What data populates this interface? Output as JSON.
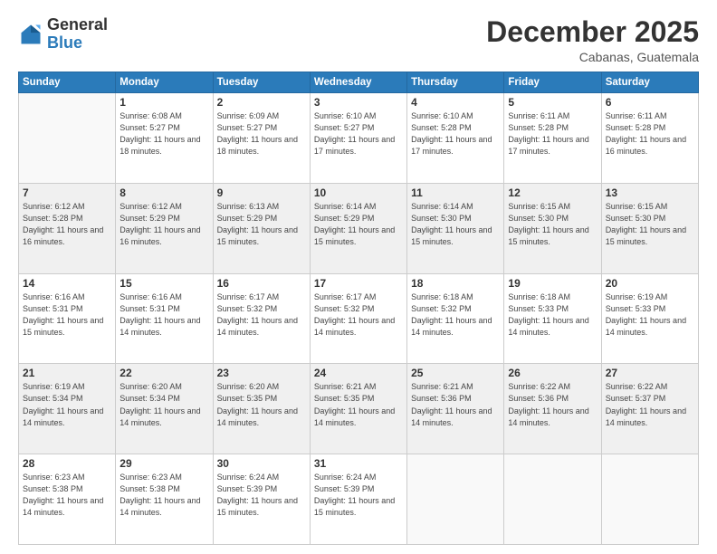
{
  "header": {
    "logo_general": "General",
    "logo_blue": "Blue",
    "month": "December 2025",
    "location": "Cabanas, Guatemala"
  },
  "weekdays": [
    "Sunday",
    "Monday",
    "Tuesday",
    "Wednesday",
    "Thursday",
    "Friday",
    "Saturday"
  ],
  "weeks": [
    [
      {
        "day": "",
        "empty": true
      },
      {
        "day": "1",
        "sunrise": "6:08 AM",
        "sunset": "5:27 PM",
        "daylight": "11 hours and 18 minutes."
      },
      {
        "day": "2",
        "sunrise": "6:09 AM",
        "sunset": "5:27 PM",
        "daylight": "11 hours and 18 minutes."
      },
      {
        "day": "3",
        "sunrise": "6:10 AM",
        "sunset": "5:27 PM",
        "daylight": "11 hours and 17 minutes."
      },
      {
        "day": "4",
        "sunrise": "6:10 AM",
        "sunset": "5:28 PM",
        "daylight": "11 hours and 17 minutes."
      },
      {
        "day": "5",
        "sunrise": "6:11 AM",
        "sunset": "5:28 PM",
        "daylight": "11 hours and 17 minutes."
      },
      {
        "day": "6",
        "sunrise": "6:11 AM",
        "sunset": "5:28 PM",
        "daylight": "11 hours and 16 minutes."
      }
    ],
    [
      {
        "day": "7",
        "sunrise": "6:12 AM",
        "sunset": "5:28 PM",
        "daylight": "11 hours and 16 minutes."
      },
      {
        "day": "8",
        "sunrise": "6:12 AM",
        "sunset": "5:29 PM",
        "daylight": "11 hours and 16 minutes."
      },
      {
        "day": "9",
        "sunrise": "6:13 AM",
        "sunset": "5:29 PM",
        "daylight": "11 hours and 15 minutes."
      },
      {
        "day": "10",
        "sunrise": "6:14 AM",
        "sunset": "5:29 PM",
        "daylight": "11 hours and 15 minutes."
      },
      {
        "day": "11",
        "sunrise": "6:14 AM",
        "sunset": "5:30 PM",
        "daylight": "11 hours and 15 minutes."
      },
      {
        "day": "12",
        "sunrise": "6:15 AM",
        "sunset": "5:30 PM",
        "daylight": "11 hours and 15 minutes."
      },
      {
        "day": "13",
        "sunrise": "6:15 AM",
        "sunset": "5:30 PM",
        "daylight": "11 hours and 15 minutes."
      }
    ],
    [
      {
        "day": "14",
        "sunrise": "6:16 AM",
        "sunset": "5:31 PM",
        "daylight": "11 hours and 15 minutes."
      },
      {
        "day": "15",
        "sunrise": "6:16 AM",
        "sunset": "5:31 PM",
        "daylight": "11 hours and 14 minutes."
      },
      {
        "day": "16",
        "sunrise": "6:17 AM",
        "sunset": "5:32 PM",
        "daylight": "11 hours and 14 minutes."
      },
      {
        "day": "17",
        "sunrise": "6:17 AM",
        "sunset": "5:32 PM",
        "daylight": "11 hours and 14 minutes."
      },
      {
        "day": "18",
        "sunrise": "6:18 AM",
        "sunset": "5:32 PM",
        "daylight": "11 hours and 14 minutes."
      },
      {
        "day": "19",
        "sunrise": "6:18 AM",
        "sunset": "5:33 PM",
        "daylight": "11 hours and 14 minutes."
      },
      {
        "day": "20",
        "sunrise": "6:19 AM",
        "sunset": "5:33 PM",
        "daylight": "11 hours and 14 minutes."
      }
    ],
    [
      {
        "day": "21",
        "sunrise": "6:19 AM",
        "sunset": "5:34 PM",
        "daylight": "11 hours and 14 minutes."
      },
      {
        "day": "22",
        "sunrise": "6:20 AM",
        "sunset": "5:34 PM",
        "daylight": "11 hours and 14 minutes."
      },
      {
        "day": "23",
        "sunrise": "6:20 AM",
        "sunset": "5:35 PM",
        "daylight": "11 hours and 14 minutes."
      },
      {
        "day": "24",
        "sunrise": "6:21 AM",
        "sunset": "5:35 PM",
        "daylight": "11 hours and 14 minutes."
      },
      {
        "day": "25",
        "sunrise": "6:21 AM",
        "sunset": "5:36 PM",
        "daylight": "11 hours and 14 minutes."
      },
      {
        "day": "26",
        "sunrise": "6:22 AM",
        "sunset": "5:36 PM",
        "daylight": "11 hours and 14 minutes."
      },
      {
        "day": "27",
        "sunrise": "6:22 AM",
        "sunset": "5:37 PM",
        "daylight": "11 hours and 14 minutes."
      }
    ],
    [
      {
        "day": "28",
        "sunrise": "6:23 AM",
        "sunset": "5:38 PM",
        "daylight": "11 hours and 14 minutes."
      },
      {
        "day": "29",
        "sunrise": "6:23 AM",
        "sunset": "5:38 PM",
        "daylight": "11 hours and 14 minutes."
      },
      {
        "day": "30",
        "sunrise": "6:24 AM",
        "sunset": "5:39 PM",
        "daylight": "11 hours and 15 minutes."
      },
      {
        "day": "31",
        "sunrise": "6:24 AM",
        "sunset": "5:39 PM",
        "daylight": "11 hours and 15 minutes."
      },
      {
        "day": "",
        "empty": true
      },
      {
        "day": "",
        "empty": true
      },
      {
        "day": "",
        "empty": true
      }
    ]
  ]
}
